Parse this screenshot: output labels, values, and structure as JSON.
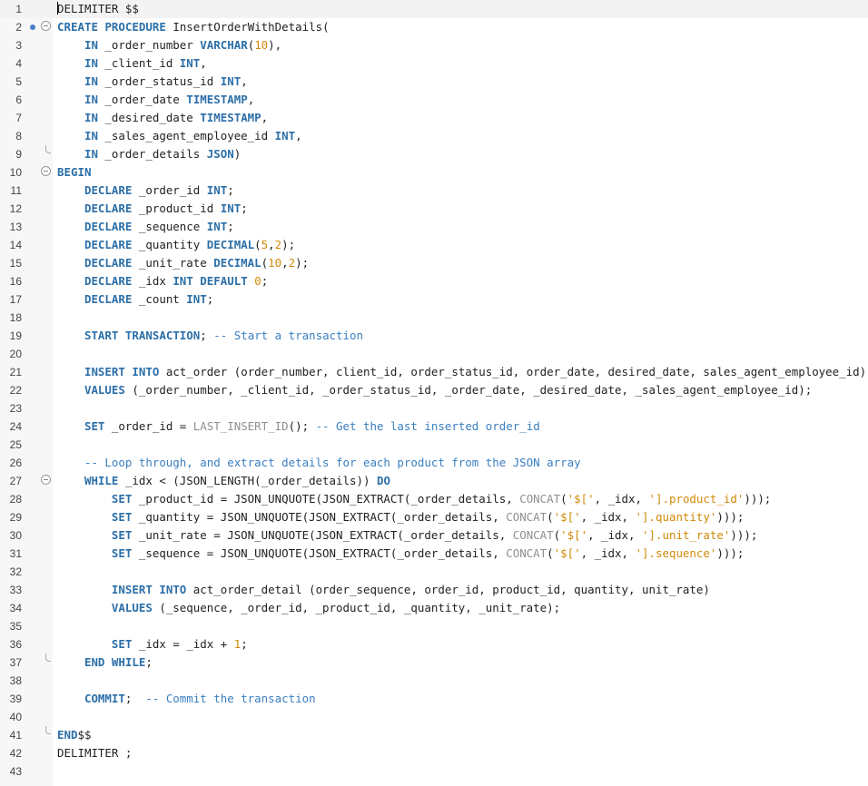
{
  "editor": {
    "language": "SQL",
    "current_line": 1,
    "lines": [
      [
        [
          "DELIMITER $$",
          "plain"
        ]
      ],
      [
        [
          "CREATE",
          "kw"
        ],
        [
          " ",
          "plain"
        ],
        [
          "PROCEDURE",
          "kw"
        ],
        [
          " InsertOrderWithDetails(",
          "plain"
        ]
      ],
      [
        [
          "    ",
          "plain"
        ],
        [
          "IN",
          "kw"
        ],
        [
          " _order_number ",
          "plain"
        ],
        [
          "VARCHAR",
          "ty"
        ],
        [
          "(",
          "plain"
        ],
        [
          "10",
          "num"
        ],
        [
          "),",
          "plain"
        ]
      ],
      [
        [
          "    ",
          "plain"
        ],
        [
          "IN",
          "kw"
        ],
        [
          " _client_id ",
          "plain"
        ],
        [
          "INT",
          "ty"
        ],
        [
          ",",
          "plain"
        ]
      ],
      [
        [
          "    ",
          "plain"
        ],
        [
          "IN",
          "kw"
        ],
        [
          " _order_status_id ",
          "plain"
        ],
        [
          "INT",
          "ty"
        ],
        [
          ",",
          "plain"
        ]
      ],
      [
        [
          "    ",
          "plain"
        ],
        [
          "IN",
          "kw"
        ],
        [
          " _order_date ",
          "plain"
        ],
        [
          "TIMESTAMP",
          "ty"
        ],
        [
          ",",
          "plain"
        ]
      ],
      [
        [
          "    ",
          "plain"
        ],
        [
          "IN",
          "kw"
        ],
        [
          " _desired_date ",
          "plain"
        ],
        [
          "TIMESTAMP",
          "ty"
        ],
        [
          ",",
          "plain"
        ]
      ],
      [
        [
          "    ",
          "plain"
        ],
        [
          "IN",
          "kw"
        ],
        [
          " _sales_agent_employee_id ",
          "plain"
        ],
        [
          "INT",
          "ty"
        ],
        [
          ",",
          "plain"
        ]
      ],
      [
        [
          "    ",
          "plain"
        ],
        [
          "IN",
          "kw"
        ],
        [
          " _order_details ",
          "plain"
        ],
        [
          "JSON",
          "ty"
        ],
        [
          ")",
          "plain"
        ]
      ],
      [
        [
          "BEGIN",
          "kw"
        ]
      ],
      [
        [
          "    ",
          "plain"
        ],
        [
          "DECLARE",
          "kw"
        ],
        [
          " _order_id ",
          "plain"
        ],
        [
          "INT",
          "ty"
        ],
        [
          ";",
          "plain"
        ]
      ],
      [
        [
          "    ",
          "plain"
        ],
        [
          "DECLARE",
          "kw"
        ],
        [
          " _product_id ",
          "plain"
        ],
        [
          "INT",
          "ty"
        ],
        [
          ";",
          "plain"
        ]
      ],
      [
        [
          "    ",
          "plain"
        ],
        [
          "DECLARE",
          "kw"
        ],
        [
          " _sequence ",
          "plain"
        ],
        [
          "INT",
          "ty"
        ],
        [
          ";",
          "plain"
        ]
      ],
      [
        [
          "    ",
          "plain"
        ],
        [
          "DECLARE",
          "kw"
        ],
        [
          " _quantity ",
          "plain"
        ],
        [
          "DECIMAL",
          "ty"
        ],
        [
          "(",
          "plain"
        ],
        [
          "5",
          "num"
        ],
        [
          ",",
          "plain"
        ],
        [
          "2",
          "num"
        ],
        [
          ");",
          "plain"
        ]
      ],
      [
        [
          "    ",
          "plain"
        ],
        [
          "DECLARE",
          "kw"
        ],
        [
          " _unit_rate ",
          "plain"
        ],
        [
          "DECIMAL",
          "ty"
        ],
        [
          "(",
          "plain"
        ],
        [
          "10",
          "num"
        ],
        [
          ",",
          "plain"
        ],
        [
          "2",
          "num"
        ],
        [
          ");",
          "plain"
        ]
      ],
      [
        [
          "    ",
          "plain"
        ],
        [
          "DECLARE",
          "kw"
        ],
        [
          " _idx ",
          "plain"
        ],
        [
          "INT",
          "ty"
        ],
        [
          " ",
          "plain"
        ],
        [
          "DEFAULT",
          "kw"
        ],
        [
          " ",
          "plain"
        ],
        [
          "0",
          "num"
        ],
        [
          ";",
          "plain"
        ]
      ],
      [
        [
          "    ",
          "plain"
        ],
        [
          "DECLARE",
          "kw"
        ],
        [
          " _count ",
          "plain"
        ],
        [
          "INT",
          "ty"
        ],
        [
          ";",
          "plain"
        ]
      ],
      [],
      [
        [
          "    ",
          "plain"
        ],
        [
          "START",
          "kw"
        ],
        [
          " ",
          "plain"
        ],
        [
          "TRANSACTION",
          "kw"
        ],
        [
          "; ",
          "plain"
        ],
        [
          "-- Start a transaction",
          "cm"
        ]
      ],
      [],
      [
        [
          "    ",
          "plain"
        ],
        [
          "INSERT",
          "kw"
        ],
        [
          " ",
          "plain"
        ],
        [
          "INTO",
          "kw"
        ],
        [
          " act_order (order_number, client_id, order_status_id, order_date, desired_date, sales_agent_employee_id)",
          "plain"
        ]
      ],
      [
        [
          "    ",
          "plain"
        ],
        [
          "VALUES",
          "kw"
        ],
        [
          " (_order_number, _client_id, _order_status_id, _order_date, _desired_date, _sales_agent_employee_id);",
          "plain"
        ]
      ],
      [],
      [
        [
          "    ",
          "plain"
        ],
        [
          "SET",
          "kw"
        ],
        [
          " _order_id = ",
          "plain"
        ],
        [
          "LAST_INSERT_ID",
          "fn"
        ],
        [
          "(); ",
          "plain"
        ],
        [
          "-- Get the last inserted order_id",
          "cm"
        ]
      ],
      [],
      [
        [
          "    ",
          "plain"
        ],
        [
          "-- Loop through, and extract details for each product from the JSON array",
          "cm"
        ]
      ],
      [
        [
          "    ",
          "plain"
        ],
        [
          "WHILE",
          "kw"
        ],
        [
          " _idx < (JSON_LENGTH(_order_details)) ",
          "plain"
        ],
        [
          "DO",
          "kw"
        ]
      ],
      [
        [
          "        ",
          "plain"
        ],
        [
          "SET",
          "kw"
        ],
        [
          " _product_id = JSON_UNQUOTE(JSON_EXTRACT(_order_details, ",
          "plain"
        ],
        [
          "CONCAT",
          "fn"
        ],
        [
          "(",
          "plain"
        ],
        [
          "'$['",
          "str"
        ],
        [
          ", _idx, ",
          "plain"
        ],
        [
          "'].product_id'",
          "str"
        ],
        [
          ")));",
          "plain"
        ]
      ],
      [
        [
          "        ",
          "plain"
        ],
        [
          "SET",
          "kw"
        ],
        [
          " _quantity = JSON_UNQUOTE(JSON_EXTRACT(_order_details, ",
          "plain"
        ],
        [
          "CONCAT",
          "fn"
        ],
        [
          "(",
          "plain"
        ],
        [
          "'$['",
          "str"
        ],
        [
          ", _idx, ",
          "plain"
        ],
        [
          "'].quantity'",
          "str"
        ],
        [
          ")));",
          "plain"
        ]
      ],
      [
        [
          "        ",
          "plain"
        ],
        [
          "SET",
          "kw"
        ],
        [
          " _unit_rate = JSON_UNQUOTE(JSON_EXTRACT(_order_details, ",
          "plain"
        ],
        [
          "CONCAT",
          "fn"
        ],
        [
          "(",
          "plain"
        ],
        [
          "'$['",
          "str"
        ],
        [
          ", _idx, ",
          "plain"
        ],
        [
          "'].unit_rate'",
          "str"
        ],
        [
          ")));",
          "plain"
        ]
      ],
      [
        [
          "        ",
          "plain"
        ],
        [
          "SET",
          "kw"
        ],
        [
          " _sequence = JSON_UNQUOTE(JSON_EXTRACT(_order_details, ",
          "plain"
        ],
        [
          "CONCAT",
          "fn"
        ],
        [
          "(",
          "plain"
        ],
        [
          "'$['",
          "str"
        ],
        [
          ", _idx, ",
          "plain"
        ],
        [
          "'].sequence'",
          "str"
        ],
        [
          ")));",
          "plain"
        ]
      ],
      [],
      [
        [
          "        ",
          "plain"
        ],
        [
          "INSERT",
          "kw"
        ],
        [
          " ",
          "plain"
        ],
        [
          "INTO",
          "kw"
        ],
        [
          " act_order_detail (order_sequence, order_id, product_id, quantity, unit_rate)",
          "plain"
        ]
      ],
      [
        [
          "        ",
          "plain"
        ],
        [
          "VALUES",
          "kw"
        ],
        [
          " (_sequence, _order_id, _product_id, _quantity, _unit_rate);",
          "plain"
        ]
      ],
      [],
      [
        [
          "        ",
          "plain"
        ],
        [
          "SET",
          "kw"
        ],
        [
          " _idx = _idx + ",
          "plain"
        ],
        [
          "1",
          "num"
        ],
        [
          ";",
          "plain"
        ]
      ],
      [
        [
          "    ",
          "plain"
        ],
        [
          "END",
          "kw"
        ],
        [
          " ",
          "plain"
        ],
        [
          "WHILE",
          "kw"
        ],
        [
          ";",
          "plain"
        ]
      ],
      [],
      [
        [
          "    ",
          "plain"
        ],
        [
          "COMMIT",
          "kw"
        ],
        [
          ";  ",
          "plain"
        ],
        [
          "-- Commit the transaction",
          "cm"
        ]
      ],
      [],
      [
        [
          "END",
          "kw"
        ],
        [
          "$$",
          "plain"
        ]
      ],
      [
        [
          "DELIMITER ;",
          "plain"
        ]
      ],
      []
    ],
    "markers": {
      "breakpoints": [
        2
      ],
      "fold_starts": [
        2,
        10,
        27
      ],
      "fold_ends": [
        9,
        37,
        41
      ]
    },
    "colors": {
      "keyword": "#2c6fa8",
      "number_string": "#d18a0a",
      "comment": "#3a7fc0",
      "builtin": "#909090",
      "text": "#222222",
      "breakpoint": "#4a80c8"
    }
  }
}
